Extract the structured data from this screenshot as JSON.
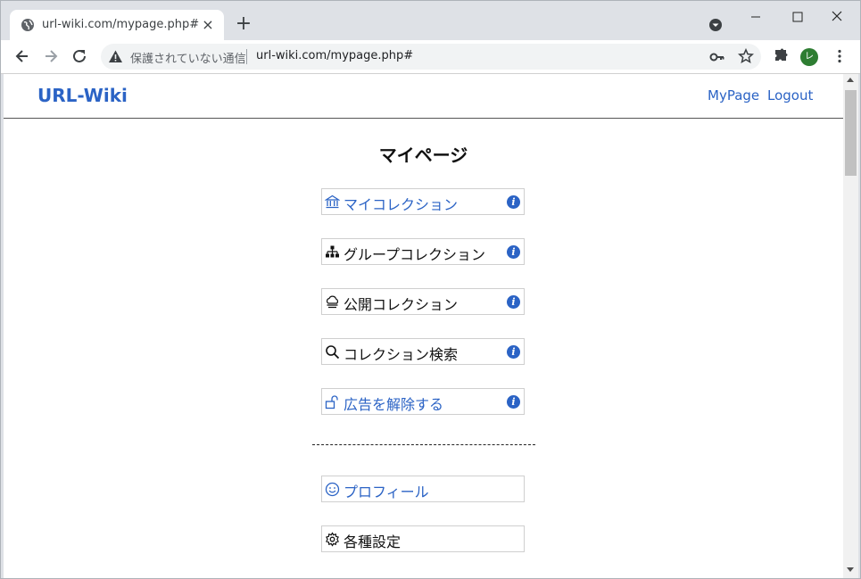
{
  "browser": {
    "tab_title": "url-wiki.com/mypage.php#",
    "tab_close": "×",
    "new_tab": "+",
    "security_label": "保護されていない通信",
    "url": "url-wiki.com/mypage.php#",
    "avatar_initial": "レ"
  },
  "header": {
    "brand": "URL-Wiki",
    "nav": [
      {
        "label": "MyPage"
      },
      {
        "label": "Logout"
      }
    ]
  },
  "page": {
    "title": "マイページ"
  },
  "menu": [
    {
      "label": "マイコレクション",
      "icon": "bank-icon",
      "color": "#2b63c5",
      "info": "i"
    },
    {
      "label": "グループコレクション",
      "icon": "sitemap-icon",
      "color": "#111111",
      "info": "i"
    },
    {
      "label": "公開コレクション",
      "icon": "cloud-icon",
      "color": "#111111",
      "info": "i"
    },
    {
      "label": "コレクション検索",
      "icon": "search-icon",
      "color": "#111111",
      "info": "i"
    },
    {
      "label": "広告を解除する",
      "icon": "unlock-icon",
      "color": "#2b63c5",
      "info": "i"
    }
  ],
  "menu2": [
    {
      "label": "プロフィール",
      "icon": "smile-icon",
      "color": "#2b63c5"
    },
    {
      "label": "各種設定",
      "icon": "gear-icon",
      "color": "#111111"
    }
  ],
  "colors": {
    "link": "#2b63c5",
    "info": "#2b63c5"
  }
}
